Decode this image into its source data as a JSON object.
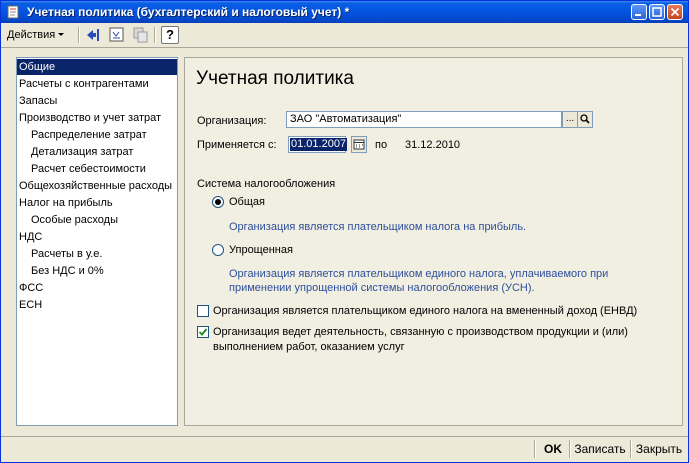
{
  "window": {
    "title": "Учетная политика (бухгалтерский и налоговый учет) *",
    "colors": {
      "titlebar": "#0454E0",
      "selection": "#0A246A",
      "note_text": "#2E4F9B"
    }
  },
  "toolbar": {
    "actions_label": "Действия",
    "help_label": "?"
  },
  "tree": [
    {
      "label": "Общие",
      "level": 0,
      "selected": true
    },
    {
      "label": "Расчеты с контрагентами",
      "level": 0
    },
    {
      "label": "Запасы",
      "level": 0
    },
    {
      "label": "Производство и учет затрат",
      "level": 0
    },
    {
      "label": "Распределение затрат",
      "level": 1
    },
    {
      "label": "Детализация затрат",
      "level": 1
    },
    {
      "label": "Расчет себестоимости",
      "level": 1
    },
    {
      "label": "Общехозяйственные расходы",
      "level": 0
    },
    {
      "label": "Налог на прибыль",
      "level": 0
    },
    {
      "label": "Особые расходы",
      "level": 1
    },
    {
      "label": "НДС",
      "level": 0
    },
    {
      "label": "Расчеты в у.е.",
      "level": 1
    },
    {
      "label": "Без НДС и 0%",
      "level": 1
    },
    {
      "label": "ФСС",
      "level": 0
    },
    {
      "label": "ЕСН",
      "level": 0
    }
  ],
  "form": {
    "heading": "Учетная политика",
    "org_label": "Организация:",
    "org_value": "ЗАО \"Автоматизация\"",
    "org_select_label": "...",
    "applies_label": "Применяется с:",
    "applies_value": "01.01.2007",
    "to_label": "по",
    "to_value": "31.12.2010",
    "tax_system_label": "Система налогообложения",
    "radio_general_label": "Общая",
    "radio_general_note": "Организация является плательщиком налога на прибыль.",
    "radio_simplified_label": "Упрощенная",
    "radio_simplified_note_1": "Организация является плательщиком единого налога, уплачиваемого при",
    "radio_simplified_note_2": "применении упрощенной системы налогообложения (УСН).",
    "envd_label": "Организация  является плательщиком единого налога на вмененный доход (ЕНВД)",
    "production_label_1": "Организация ведет деятельность, связанную с производством продукции и (или)",
    "production_label_2": "выполнением работ, оказанием услуг",
    "selected_tax_system": "Общая",
    "envd_checked": false,
    "production_checked": true
  },
  "buttons": {
    "ok": "OK",
    "save": "Записать",
    "close": "Закрыть"
  }
}
